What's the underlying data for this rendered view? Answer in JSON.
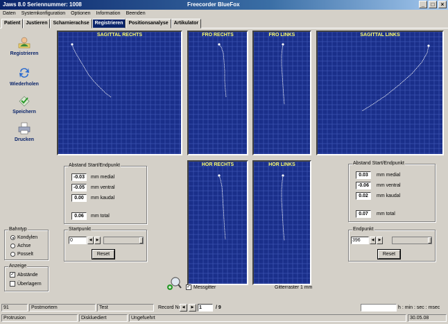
{
  "window": {
    "title": "Jaws 8.0   Seriennummer: 1008",
    "device": "Freecorder BlueFox",
    "controls": [
      "_",
      "□",
      "×"
    ]
  },
  "menu": [
    "Daten",
    "Systemkonfiguration",
    "Optionen",
    "Information",
    "Beenden"
  ],
  "tabs": [
    "Patient",
    "Justieren",
    "Scharnierachse",
    "Registrieren",
    "Positionsanalyse",
    "Artikulator"
  ],
  "active_tab": "Registrieren",
  "toolbar": {
    "registrieren": "Registrieren",
    "wiederholen": "Wiederholen",
    "speichern": "Speichern",
    "drucken": "Drucken"
  },
  "panels": {
    "sagittal_rechts": "SAGITTAL RECHTS",
    "fro_rechts": "FRO RECHTS",
    "fro_links": "FRO LINKS",
    "sagittal_links": "SAGITTAL LINKS",
    "hor_rechts": "HOR RECHTS",
    "hor_links": "HOR LINKS"
  },
  "left_distance": {
    "title": "Abstand Start/Endpunkt",
    "medial": "-0.03",
    "ventral": "-0.05",
    "kaudal": "0.00",
    "total": "0.06",
    "unit_medial": "mm medial",
    "unit_ventral": "mm ventral",
    "unit_kaudal": "mm kaudal",
    "unit_total": "mm total"
  },
  "right_distance": {
    "title": "Abstand Start/Endpunkt",
    "medial": "0.03",
    "ventral": "-0.06",
    "kaudal": "0.02",
    "total": "0.07",
    "unit_medial": "mm medial",
    "unit_ventral": "mm ventral",
    "unit_kaudal": "mm kaudal",
    "unit_total": "mm total"
  },
  "bahntyp": {
    "title": "Bahntyp",
    "options": [
      "Kondylen",
      "Achse",
      "Posselt"
    ],
    "selected": "Kondylen"
  },
  "anzeige": {
    "title": "Anzeige",
    "abstaende": "Abstände",
    "ueberlagern": "Überlagern",
    "abstaende_checked": "✓"
  },
  "startpunkt": {
    "title": "Startpunkt",
    "value": "0",
    "reset": "Reset"
  },
  "endpunkt": {
    "title": "Endpunkt",
    "value": "396",
    "reset": "Reset"
  },
  "messgitter": {
    "label": "Messgitter",
    "checked": "✓"
  },
  "gitterraster": "Gitterraster 1 mm",
  "status1": {
    "id": "91",
    "type": "Postmortem",
    "name": "Test",
    "record_label": "Record Nr.",
    "record_value": "1",
    "record_total": "/  9",
    "time_format": "h : min : sec : msec"
  },
  "status2": {
    "a": "Protrusion",
    "b": "Diskluediert",
    "c": "Ungefuehrt",
    "date": "30.05.08"
  }
}
